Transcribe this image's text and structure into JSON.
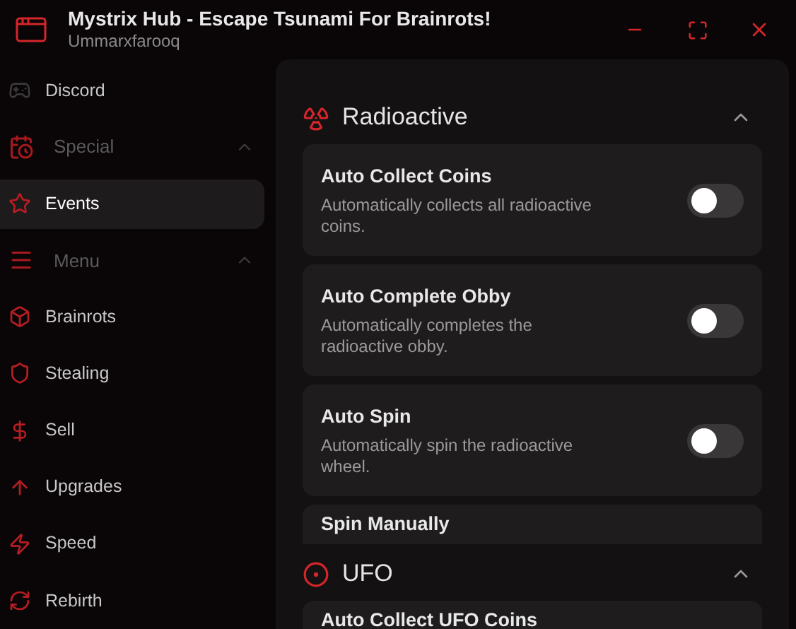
{
  "window": {
    "title": "Mystrix Hub - Escape Tsunami For Brainrots!",
    "subtitle": "Ummarxfarooq"
  },
  "sidebar": [
    {
      "kind": "item",
      "label": "Discord",
      "selected": false
    },
    {
      "kind": "group",
      "label": "Special",
      "expanded": true
    },
    {
      "kind": "item",
      "label": "Events",
      "selected": true
    },
    {
      "kind": "group",
      "label": "Menu",
      "expanded": true
    },
    {
      "kind": "item",
      "label": "Brainrots",
      "selected": false
    },
    {
      "kind": "item",
      "label": "Stealing",
      "selected": false
    },
    {
      "kind": "item",
      "label": "Sell",
      "selected": false
    },
    {
      "kind": "item",
      "label": "Upgrades",
      "selected": false
    },
    {
      "kind": "item",
      "label": "Speed",
      "selected": false
    },
    {
      "kind": "item",
      "label": "Rebirth",
      "selected": false
    }
  ],
  "sections": [
    {
      "title": "Radioactive",
      "expanded": true,
      "toggles": [
        {
          "title": "Auto Collect Coins",
          "description": "Automatically collects all radioactive coins.",
          "on": false
        },
        {
          "title": "Auto Complete Obby",
          "description": "Automatically completes the radioactive obby.",
          "on": false
        },
        {
          "title": "Auto Spin",
          "description": "Automatically spin the radioactive wheel.",
          "on": false
        },
        {
          "title": "Spin Manually"
        }
      ]
    },
    {
      "title": "UFO",
      "expanded": true,
      "toggles": [
        {
          "title": "Auto Collect UFO Coins"
        }
      ]
    }
  ]
}
